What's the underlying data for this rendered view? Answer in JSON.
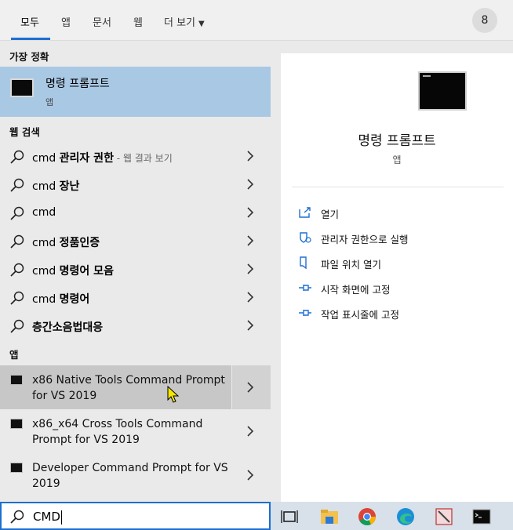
{
  "tabs": [
    {
      "label": "모두"
    },
    {
      "label": "앱"
    },
    {
      "label": "문서"
    },
    {
      "label": "웹"
    },
    {
      "label": "더 보기"
    }
  ],
  "user_badge": "8",
  "best_match": {
    "header": "가장 정확",
    "title": "명령 프롬프트",
    "subtitle": "앱"
  },
  "web_search": {
    "header": "웹 검색",
    "items": [
      {
        "prefix": "cmd ",
        "bold": "관리자 권한",
        "suffix": " - 웹 결과 보기"
      },
      {
        "prefix": "cmd ",
        "bold": "장난",
        "suffix": ""
      },
      {
        "prefix": "cmd",
        "bold": "",
        "suffix": ""
      },
      {
        "prefix": "cmd ",
        "bold": "정품인증",
        "suffix": ""
      },
      {
        "prefix": "cmd ",
        "bold": "명령어 모음",
        "suffix": ""
      },
      {
        "prefix": "cmd ",
        "bold": "명령어",
        "suffix": ""
      },
      {
        "prefix": "",
        "bold": "층간소음법대응",
        "suffix": ""
      }
    ]
  },
  "apps": {
    "header": "앱",
    "items": [
      {
        "label": "x86 Native Tools Command Prompt for VS 2019"
      },
      {
        "label": "x86_x64 Cross Tools Command Prompt for VS 2019"
      },
      {
        "label": "Developer Command Prompt for VS 2019"
      }
    ]
  },
  "preview": {
    "title": "명령 프롬프트",
    "subtitle": "앱",
    "actions": [
      {
        "label": "열기",
        "icon": "open-icon"
      },
      {
        "label": "관리자 권한으로 실행",
        "icon": "shield-icon"
      },
      {
        "label": "파일 위치 열기",
        "icon": "file-location-icon"
      },
      {
        "label": "시작 화면에 고정",
        "icon": "pin-icon"
      },
      {
        "label": "작업 표시줄에 고정",
        "icon": "pin-icon"
      }
    ]
  },
  "search": {
    "value": "CMD"
  },
  "taskbar": [
    "task-view-icon",
    "file-explorer-icon",
    "chrome-icon",
    "edge-icon",
    "snipping-tool-icon",
    "cmd-icon"
  ],
  "colors": {
    "accent": "#1e6fd0",
    "best_match_bg": "#a9c8e4",
    "selected_bg": "#c7c7c7"
  }
}
